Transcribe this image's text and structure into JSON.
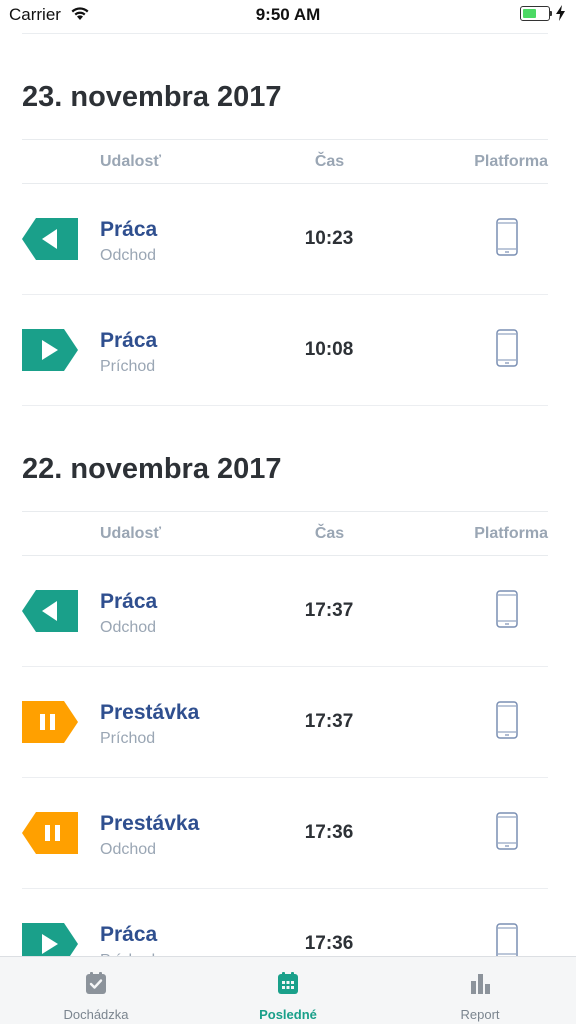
{
  "status_bar": {
    "carrier": "Carrier",
    "time": "9:50 AM",
    "battery_level": 0.55
  },
  "colors": {
    "accent": "#1aa08a",
    "work": "#1aa08a",
    "break": "#ffa000",
    "event_name": "#2f4f8f",
    "muted": "#9aa6b4"
  },
  "sections": [
    {
      "date": "23. novembra 2017",
      "headers": {
        "event": "Udalosť",
        "time": "Čas",
        "platform": "Platforma"
      },
      "rows": [
        {
          "name": "Práca",
          "type": "Odchod",
          "time": "10:23",
          "icon": "work-departure-icon",
          "platform_icon": "mobile-phone-icon"
        },
        {
          "name": "Práca",
          "type": "Príchod",
          "time": "10:08",
          "icon": "work-arrival-icon",
          "platform_icon": "mobile-phone-icon"
        }
      ]
    },
    {
      "date": "22. novembra 2017",
      "headers": {
        "event": "Udalosť",
        "time": "Čas",
        "platform": "Platforma"
      },
      "rows": [
        {
          "name": "Práca",
          "type": "Odchod",
          "time": "17:37",
          "icon": "work-departure-icon",
          "platform_icon": "mobile-phone-icon"
        },
        {
          "name": "Prestávka",
          "type": "Príchod",
          "time": "17:37",
          "icon": "break-arrival-icon",
          "platform_icon": "mobile-phone-icon"
        },
        {
          "name": "Prestávka",
          "type": "Odchod",
          "time": "17:36",
          "icon": "break-departure-icon",
          "platform_icon": "mobile-phone-icon"
        },
        {
          "name": "Práca",
          "type": "Príchod",
          "time": "17:36",
          "icon": "work-arrival-icon",
          "platform_icon": "mobile-phone-icon"
        }
      ]
    }
  ],
  "tab_bar": {
    "tabs": [
      {
        "label": "Dochádzka",
        "icon": "checklist-icon",
        "active": false
      },
      {
        "label": "Posledné",
        "icon": "calendar-icon",
        "active": true
      },
      {
        "label": "Report",
        "icon": "bar-chart-icon",
        "active": false
      }
    ]
  }
}
